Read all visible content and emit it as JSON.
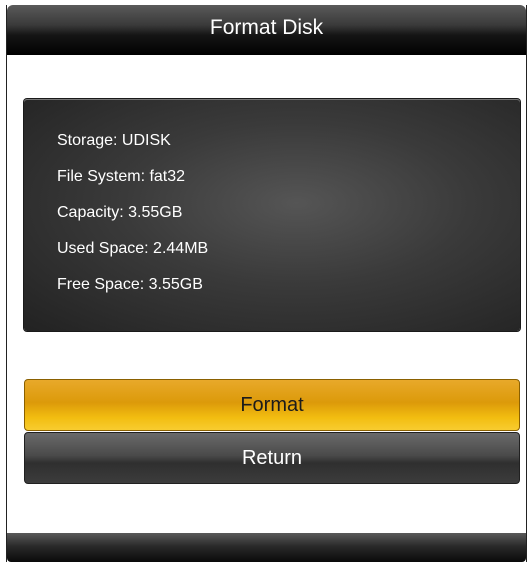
{
  "window": {
    "title": "Format Disk"
  },
  "info": {
    "storage": "Storage: UDISK",
    "file_system": "File System: fat32",
    "capacity": "Capacity: 3.55GB",
    "used_space": "Used Space: 2.44MB",
    "free_space": "Free Space: 3.55GB"
  },
  "buttons": {
    "format_label": "Format",
    "return_label": "Return"
  },
  "colors": {
    "accent": "#f2bd10",
    "titlebar": "#151515",
    "panel": "#3a3a3a"
  }
}
